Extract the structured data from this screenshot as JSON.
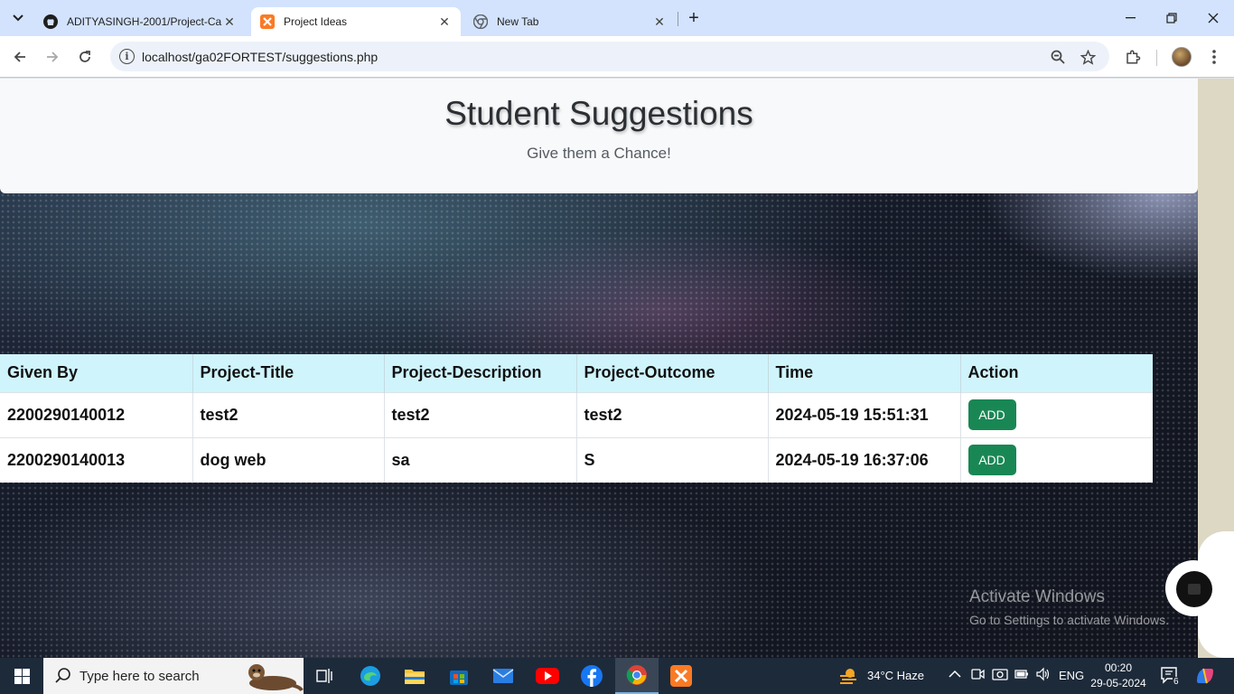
{
  "browser": {
    "tabs": [
      {
        "title": "ADITYASINGH-2001/Project-Ca",
        "icon": "github-icon"
      },
      {
        "title": "Project Ideas",
        "icon": "xampp-icon",
        "active": true
      },
      {
        "title": "New Tab",
        "icon": "chrome-icon"
      }
    ],
    "url": "localhost/ga02FORTEST/suggestions.php"
  },
  "page": {
    "title": "Student Suggestions",
    "subtitle": "Give them a Chance!",
    "table": {
      "headers": [
        "Given By",
        "Project-Title",
        "Project-Description",
        "Project-Outcome",
        "Time",
        "Action"
      ],
      "rows": [
        {
          "given_by": "2200290140012",
          "title": "test2",
          "description": "test2",
          "outcome": "test2",
          "time": "2024-05-19 15:51:31",
          "action": "ADD"
        },
        {
          "given_by": "2200290140013",
          "title": "dog web",
          "description": "sa",
          "outcome": "S",
          "time": "2024-05-19 16:37:06",
          "action": "ADD"
        }
      ]
    }
  },
  "watermark": {
    "line1": "Activate Windows",
    "line2": "Go to Settings to activate Windows."
  },
  "taskbar": {
    "search_placeholder": "Type here to search",
    "weather": "34°C  Haze",
    "language": "ENG",
    "time": "00:20",
    "date": "29-05-2024",
    "notification_count": "6"
  },
  "colors": {
    "header_bg": "#cff4fc",
    "add_button": "#198754",
    "tabstrip": "#d3e3fd"
  }
}
